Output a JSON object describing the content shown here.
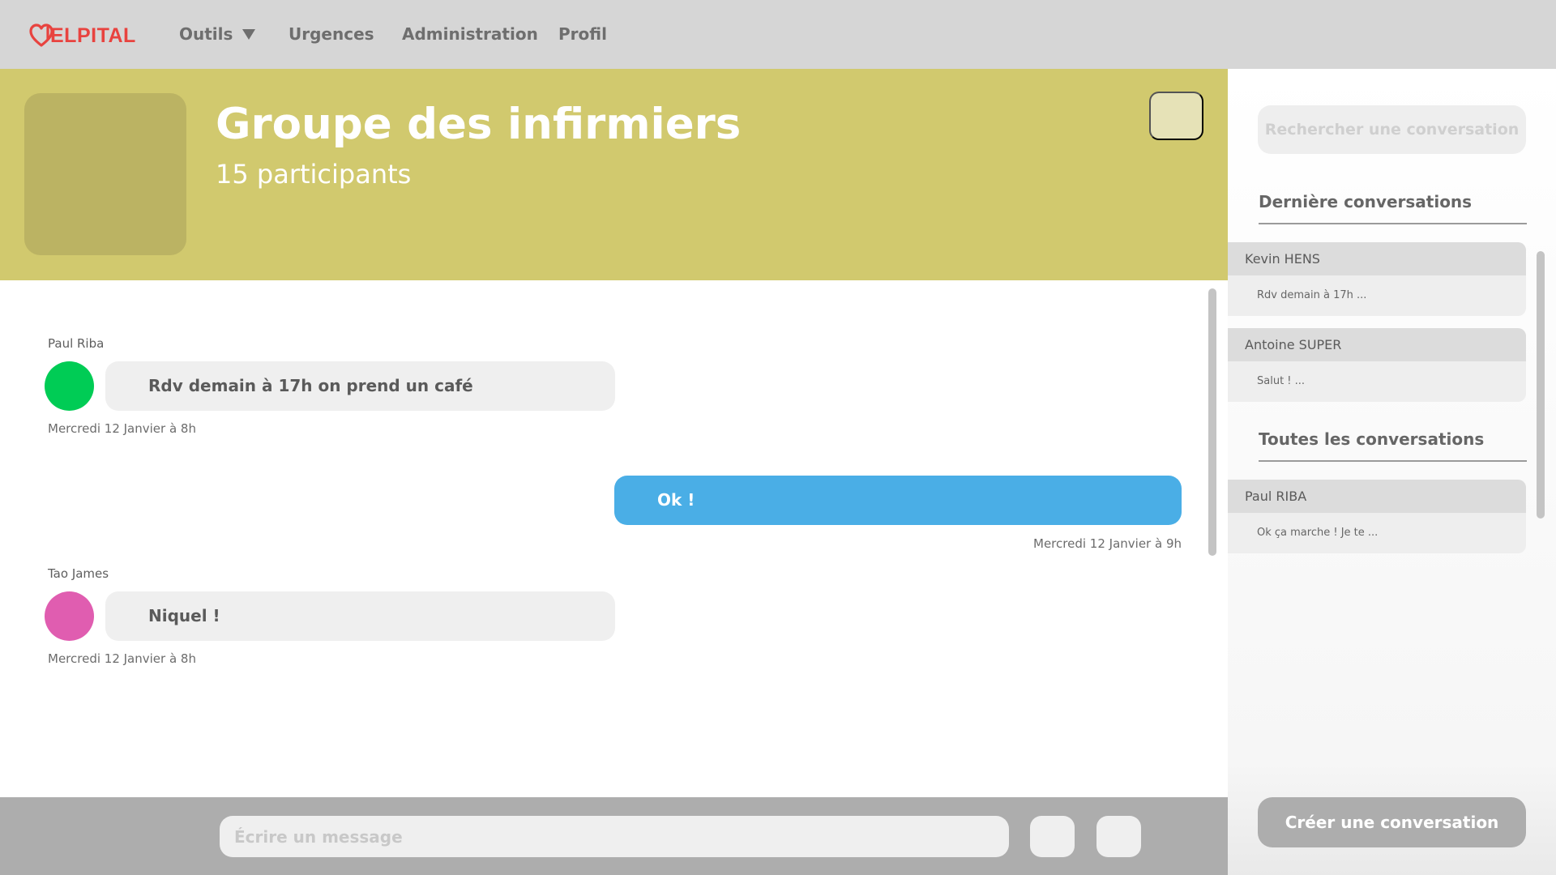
{
  "app": {
    "logo_text": "ELPITAL",
    "logo_color": "#e8433f"
  },
  "nav": {
    "outils": "Outils",
    "urgences": "Urgences",
    "administration": "Administration",
    "profil": "Profil"
  },
  "group": {
    "title": "Groupe des infirmiers",
    "participants": "15 participants",
    "header_color": "#d1c96e"
  },
  "messages": [
    {
      "sender": "Paul Riba",
      "text": "Rdv demain à 17h on prend un café",
      "time": "Mercredi 12 Janvier à 8h",
      "avatar_color": "#00cc55",
      "direction": "in"
    },
    {
      "sender": "",
      "text": "Ok !",
      "time": "Mercredi 12 Janvier à 9h",
      "bubble_color": "#4aaee6",
      "direction": "out"
    },
    {
      "sender": "Tao James",
      "text": "Niquel !",
      "time": "Mercredi 12 Janvier à 8h",
      "avatar_color": "#e05db0",
      "direction": "in"
    }
  ],
  "composer": {
    "placeholder": "Écrire un message",
    "attach_icon": "attach-icon",
    "send_icon": "send-icon"
  },
  "sidebar": {
    "search_placeholder": "Rechercher une conversation",
    "recent_title": "Dernière conversations",
    "recent": [
      {
        "name": "Kevin HENS",
        "preview": "Rdv demain à 17h ..."
      },
      {
        "name": "Antoine SUPER",
        "preview": "Salut ! ..."
      }
    ],
    "all_title": "Toutes les conversations",
    "all": [
      {
        "name": "Paul RIBA",
        "preview": "Ok ça marche ! Je te ..."
      }
    ],
    "create_label": "Créer une conversation"
  }
}
